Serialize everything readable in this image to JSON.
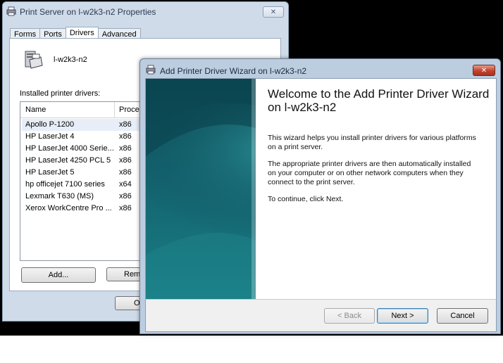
{
  "properties_window": {
    "title": "Print Server on l-w2k3-n2 Properties",
    "close_glyph": "✕",
    "tabs": [
      {
        "label": "Forms",
        "active": false
      },
      {
        "label": "Ports",
        "active": false
      },
      {
        "label": "Drivers",
        "active": true
      },
      {
        "label": "Advanced",
        "active": false
      }
    ],
    "server_name": "l-w2k3-n2",
    "installed_label": "Installed printer drivers:",
    "columns": {
      "name": "Name",
      "processor": "Proces"
    },
    "drivers": [
      {
        "name": "Apollo P-1200",
        "processor": "x86"
      },
      {
        "name": "HP LaserJet 4",
        "processor": "x86"
      },
      {
        "name": "HP LaserJet 4000 Serie...",
        "processor": "x86"
      },
      {
        "name": "HP LaserJet 4250 PCL 5",
        "processor": "x86"
      },
      {
        "name": "HP LaserJet 5",
        "processor": "x86"
      },
      {
        "name": "hp officejet 7100 series",
        "processor": "x64"
      },
      {
        "name": "Lexmark T630 (MS)",
        "processor": "x86"
      },
      {
        "name": "Xerox WorkCentre Pro ...",
        "processor": "x86"
      }
    ],
    "selected_row": 0,
    "add_button": "Add...",
    "remove_button_partial": "Rem",
    "ok_button_partial": "O"
  },
  "wizard_window": {
    "title": "Add Printer Driver Wizard on l-w2k3-n2",
    "close_glyph": "✕",
    "heading": "Welcome to the Add Printer Driver Wizard on l-w2k3-n2",
    "paragraph1": "This wizard helps you install printer drivers for various platforms on a print server.",
    "paragraph2": "The appropriate printer drivers are then automatically installed on your computer or on other network computers when they connect to the print server.",
    "paragraph3": "To continue, click Next.",
    "back_button": "< Back",
    "next_button": "Next >",
    "cancel_button": "Cancel"
  },
  "colors": {
    "wizard_art_dark": "#0a3f4a",
    "wizard_art_light": "#1e7f86",
    "close_red": "#c0432d"
  }
}
